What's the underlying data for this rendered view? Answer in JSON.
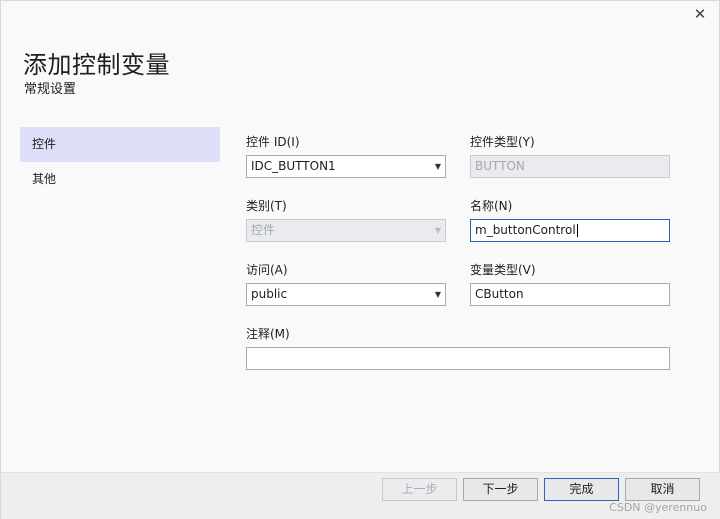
{
  "window": {
    "close_glyph": "✕",
    "title": "添加控制变量",
    "subtitle": "常规设置"
  },
  "nav": {
    "items": [
      {
        "label": "控件",
        "active": true
      },
      {
        "label": "其他",
        "active": false
      }
    ]
  },
  "form": {
    "control_id": {
      "label": "控件 ID(I)",
      "value": "IDC_BUTTON1"
    },
    "control_type": {
      "label": "控件类型(Y)",
      "value": "BUTTON"
    },
    "category": {
      "label": "类别(T)",
      "value": "控件"
    },
    "name": {
      "label": "名称(N)",
      "value": "m_buttonControl"
    },
    "access": {
      "label": "访问(A)",
      "value": "public"
    },
    "var_type": {
      "label": "变量类型(V)",
      "value": "CButton"
    },
    "comment": {
      "label": "注释(M)",
      "value": ""
    }
  },
  "buttons": {
    "prev": "上一步",
    "next": "下一步",
    "finish": "完成",
    "cancel": "取消"
  },
  "watermark": "CSDN @yerennuo",
  "colors": {
    "nav_active": "#dcdff7",
    "focus_border": "#2f5fb5"
  }
}
